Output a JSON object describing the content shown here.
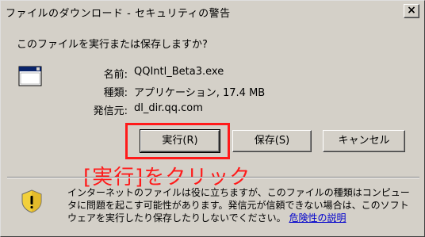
{
  "window": {
    "title": "ファイルのダウンロード - セキュリティの警告",
    "close_glyph": "×"
  },
  "dialog": {
    "question": "このファイルを実行または保存しますか?",
    "file_icon": "application-window-icon",
    "fields": [
      {
        "label": "名前:",
        "value": "QQIntl_Beta3.exe"
      },
      {
        "label": "種類:",
        "value": "アプリケーション, 17.4 MB"
      },
      {
        "label": "発信元:",
        "value": "dl_dir.qq.com"
      }
    ]
  },
  "buttons": {
    "run": "実行(R)",
    "save": "保存(S)",
    "cancel": "キャンセル"
  },
  "annotation": {
    "text": "[実行]をクリック",
    "color": "#ff1a1a"
  },
  "warning": {
    "icon": "shield-warning-icon",
    "text": "インターネットのファイルは役に立ちますが、このファイルの種類はコンピュータに問題を起こす可能性があります。発信元が信頼できない場合は、このソフトウェアを実行したり保存したりしないでください。",
    "link": "危険性の説明"
  }
}
